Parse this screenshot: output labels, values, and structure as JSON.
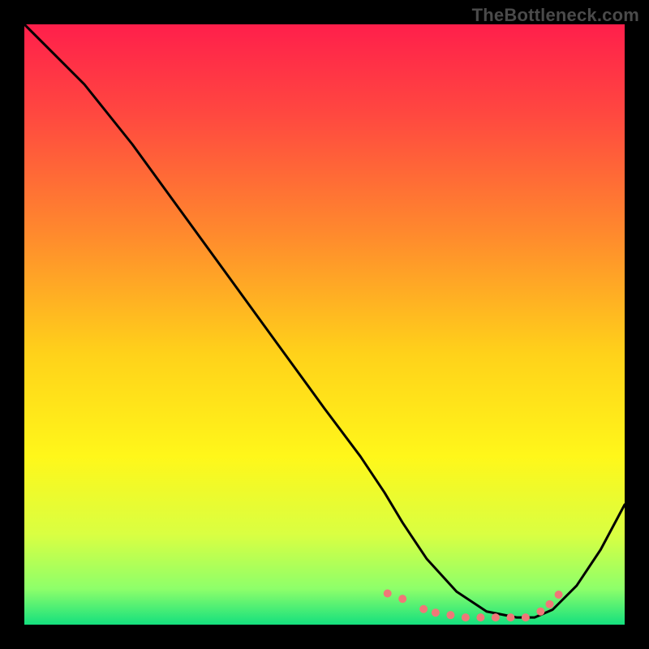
{
  "watermark": "TheBottleneck.com",
  "chart_data": {
    "type": "line",
    "title": "",
    "xlabel": "",
    "ylabel": "",
    "xlim": [
      0,
      100
    ],
    "ylim": [
      0,
      100
    ],
    "grid": false,
    "legend": false,
    "gradient_stops": [
      {
        "offset": 0,
        "color": "#ff1f4b"
      },
      {
        "offset": 0.15,
        "color": "#ff4840"
      },
      {
        "offset": 0.35,
        "color": "#ff8a2d"
      },
      {
        "offset": 0.55,
        "color": "#ffd21a"
      },
      {
        "offset": 0.72,
        "color": "#fff71a"
      },
      {
        "offset": 0.85,
        "color": "#d9ff42"
      },
      {
        "offset": 0.94,
        "color": "#8eff6a"
      },
      {
        "offset": 1.0,
        "color": "#14e07e"
      }
    ],
    "series": [
      {
        "name": "curve",
        "color": "#000000",
        "x": [
          0,
          4,
          10,
          18,
          26,
          34,
          42,
          50,
          56,
          60,
          63,
          67,
          72,
          77,
          82,
          85,
          88,
          92,
          96,
          100
        ],
        "y": [
          100,
          96,
          90,
          80,
          69,
          58,
          47,
          36,
          28,
          22,
          17,
          11,
          5.5,
          2.2,
          1.2,
          1.2,
          2.5,
          6.5,
          12.5,
          20
        ]
      }
    ],
    "markers": {
      "name": "salmon-dots",
      "color": "#f07878",
      "radius": 5,
      "points": [
        {
          "x": 60.5,
          "y": 5.2
        },
        {
          "x": 63.0,
          "y": 4.3
        },
        {
          "x": 66.5,
          "y": 2.6
        },
        {
          "x": 68.5,
          "y": 2.0
        },
        {
          "x": 71.0,
          "y": 1.6
        },
        {
          "x": 73.5,
          "y": 1.2
        },
        {
          "x": 76.0,
          "y": 1.2
        },
        {
          "x": 78.5,
          "y": 1.2
        },
        {
          "x": 81.0,
          "y": 1.2
        },
        {
          "x": 83.5,
          "y": 1.2
        },
        {
          "x": 86.0,
          "y": 2.2
        },
        {
          "x": 87.5,
          "y": 3.4
        },
        {
          "x": 89.0,
          "y": 5.0
        }
      ]
    }
  }
}
